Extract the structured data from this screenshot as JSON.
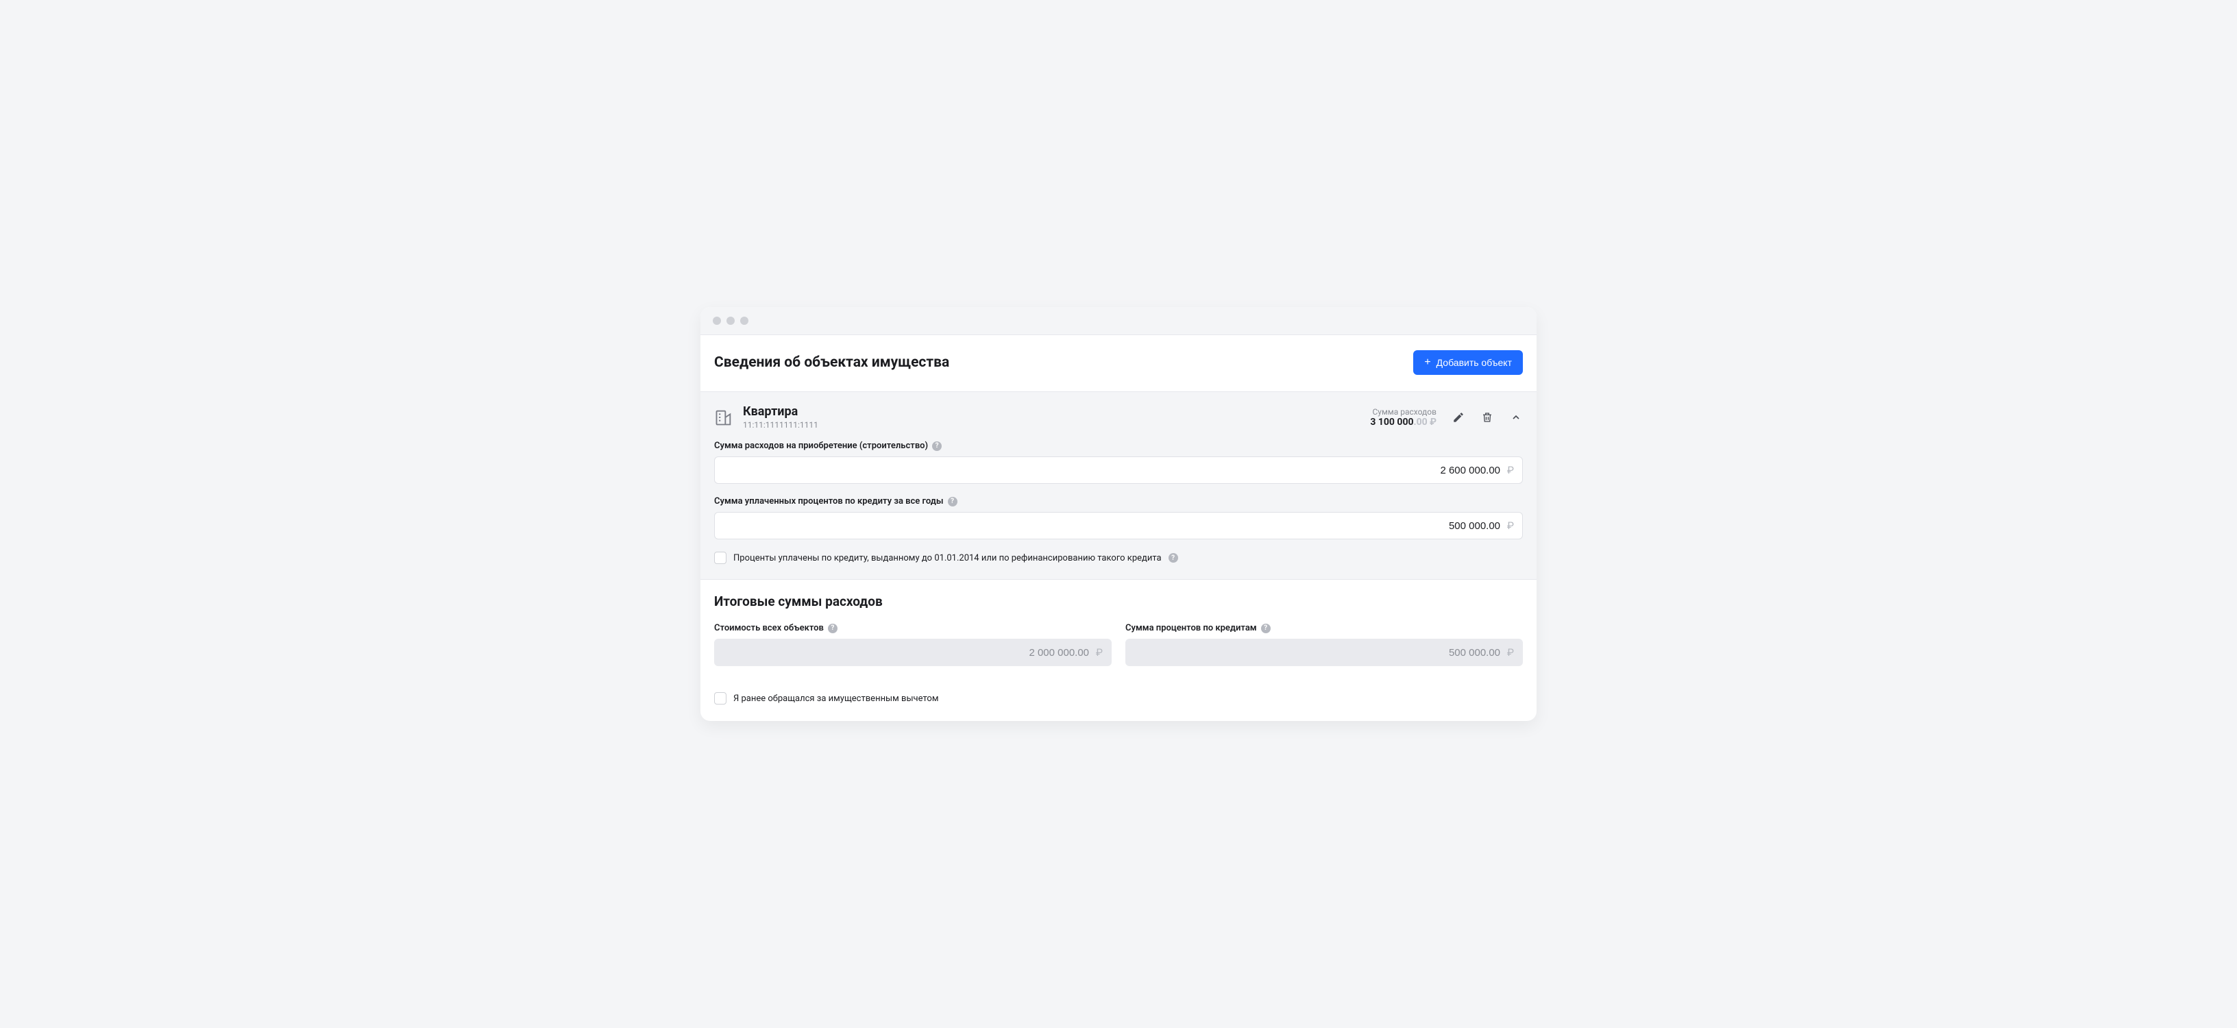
{
  "header": {
    "title": "Сведения об объектах имущества",
    "add_button": "Добавить объект"
  },
  "object": {
    "icon": "building-icon",
    "title": "Квартира",
    "cadastral": "11:11:1111111:1111",
    "sum_label": "Сумма расходов",
    "sum_main": "3 100 000",
    "sum_decimals": ".00 ₽",
    "fields": {
      "acquisition_label": "Сумма расходов на приобретение (строительство)",
      "acquisition_value": "2 600 000.00",
      "interest_label": "Сумма уплаченных процентов по кредиту за все годы",
      "interest_value": "500 000.00"
    },
    "checkbox_before_2014": "Проценты уплачены по кредиту, выданному до 01.01.2014 или по рефинансированию такого кредита"
  },
  "totals": {
    "title": "Итоговые суммы расходов",
    "all_objects_label": "Стоимость всех объектов",
    "all_objects_value": "2 000 000.00",
    "credit_interest_label": "Сумма процентов по кредитам",
    "credit_interest_value": "500 000.00",
    "checkbox_prior_deduction": "Я ранее обращался за имущественным вычетом"
  },
  "glyphs": {
    "ruble": "₽",
    "help": "?",
    "plus": "+"
  }
}
